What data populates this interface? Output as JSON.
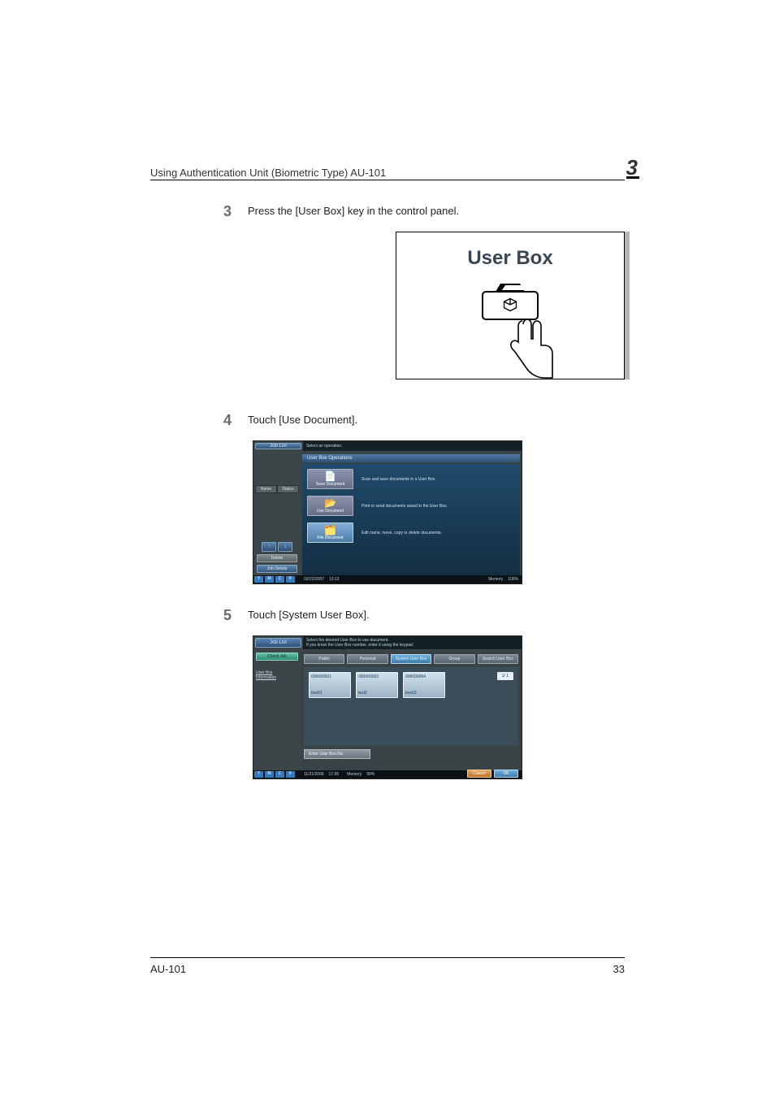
{
  "header": {
    "title": "Using Authentication Unit (Biometric Type) AU-101",
    "chapter_number": "3"
  },
  "steps": [
    {
      "num": "3",
      "text": "Press the [User Box] key in the control panel."
    },
    {
      "num": "4",
      "text": "Touch [Use Document]."
    },
    {
      "num": "5",
      "text": "Touch [System User Box]."
    }
  ],
  "userbox_panel": {
    "title": "User Box"
  },
  "shot1": {
    "joblist": "Job List",
    "msg": "Select an operation.",
    "opsbar": "User Box Operations",
    "name": "Name",
    "status": "Status",
    "delete": "Delete",
    "jobdetails": "Job Details",
    "ops": [
      {
        "label": "Save Document",
        "desc": "Scan and save documents in a User Box."
      },
      {
        "label": "Use Document",
        "desc": "Print or send documents saved in the User Box."
      },
      {
        "label": "File Document",
        "desc": "Edit name, move, copy or delete documents."
      }
    ],
    "date": "02/22/2007",
    "time": "13:12",
    "memory": "Memory",
    "mempct": "100%"
  },
  "shot2": {
    "joblist": "Job List",
    "checkjob": "Check Job",
    "msg1": "Select the desired User Box to use document.",
    "msg2": "If you know the User Box number, enter it using the keypad.",
    "tabs": [
      "Public",
      "Personal",
      "System User Box",
      "Group",
      "Search User Box"
    ],
    "boxes": [
      {
        "id": "000000001",
        "name": "box01"
      },
      {
        "id": "000000003",
        "name": "test2"
      },
      {
        "id": "000000004",
        "name": "box02"
      }
    ],
    "pager": "1/ 1",
    "enterbox": "Enter User Box No.",
    "info_line1": "User Box",
    "info_line2": "Information",
    "cancel": "Cancel",
    "ok": "OK",
    "date": "11/21/2006",
    "time": "17:05",
    "memory": "Memory",
    "mempct": "99%"
  },
  "footer": {
    "left": "AU-101",
    "right": "33"
  }
}
